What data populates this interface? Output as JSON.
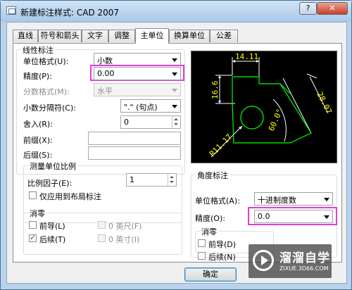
{
  "window": {
    "title": "新建标注样式: CAD 2007",
    "help": "?",
    "close": "✕"
  },
  "tabs": [
    "直线",
    "符号和箭头",
    "文字",
    "调整",
    "主单位",
    "换算单位",
    "公差"
  ],
  "linear": {
    "title": "线性标注",
    "unit_format_label": "单位格式(U):",
    "unit_format_value": "小数",
    "precision_label": "精度(P):",
    "precision_value": "0.00",
    "fraction_label": "分数格式(M):",
    "fraction_value": "水平",
    "decimal_sep_label": "小数分隔符(C):",
    "decimal_sep_value": "\".\" (句点)",
    "roundoff_label": "舍入(R):",
    "roundoff_value": "0",
    "prefix_label": "前缀(X):",
    "prefix_value": "",
    "suffix_label": "后缀(S):",
    "suffix_value": ""
  },
  "scale": {
    "title": "测量单位比例",
    "factor_label": "比例因子(E):",
    "factor_value": "1",
    "layout_only_label": "仅应用到布局标注",
    "layout_only": false
  },
  "zero_suppress_linear": {
    "title": "消零",
    "leading_label": "前导(L)",
    "leading": false,
    "trailing_label": "后续(T)",
    "trailing": true,
    "feet_label": "0 英尺(F)",
    "inches_label": "0 英寸(I)"
  },
  "angular": {
    "title": "角度标注",
    "unit_format_label": "单位格式(A):",
    "unit_format_value": "十进制度数",
    "precision_label": "精度(O):",
    "precision_value": "0.0"
  },
  "zero_suppress_angular": {
    "title": "消零",
    "leading_label": "前导(D)",
    "leading": false,
    "trailing_label": "后续(N)",
    "trailing": false
  },
  "preview": {
    "dim_top": "14.11",
    "dim_left": "16.6",
    "dim_right": "28.07",
    "dim_angle": "60.0°",
    "dim_radius": "R11.17"
  },
  "buttons": {
    "ok": "确定"
  },
  "watermark": {
    "brand": "溜溜自学",
    "url": "ZIXUE.3D66.COM"
  },
  "colors": {
    "highlight": "#e43bdc",
    "preview_bg": "#000000",
    "dim_line": "#ffffff",
    "dim_text": "#ffff00",
    "geometry": "#00ff00"
  }
}
